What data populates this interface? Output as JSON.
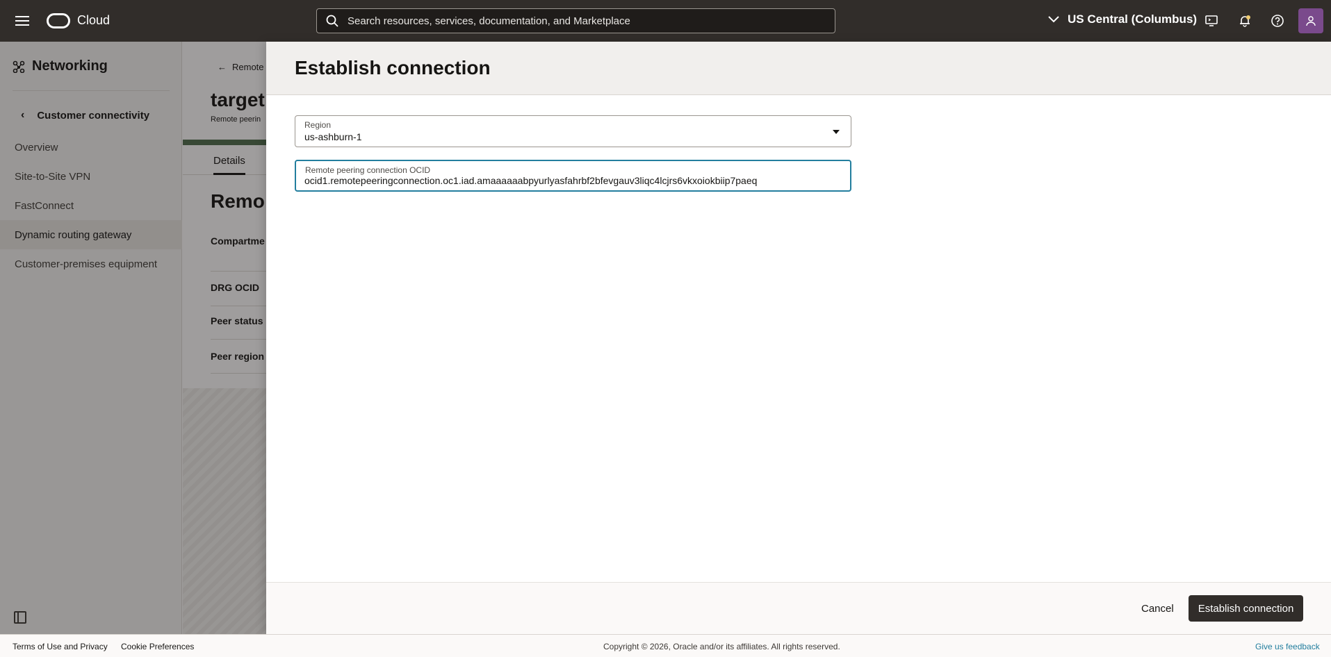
{
  "header": {
    "brand": "Cloud",
    "search_placeholder": "Search resources, services, documentation, and Marketplace",
    "region": "US Central (Columbus)",
    "icons": [
      "menu-icon",
      "oracle-logo",
      "search-icon",
      "chevron-down-icon",
      "cloud-shell-icon",
      "bell-icon",
      "help-icon",
      "user-icon"
    ]
  },
  "sidebar": {
    "title": "Networking",
    "back_label": "Customer connectivity",
    "items": [
      {
        "label": "Overview",
        "active": false
      },
      {
        "label": "Site-to-Site VPN",
        "active": false
      },
      {
        "label": "FastConnect",
        "active": false
      },
      {
        "label": "Dynamic routing gateway",
        "active": true
      },
      {
        "label": "Customer-premises equipment",
        "active": false
      }
    ]
  },
  "page": {
    "back_label": "Remote",
    "title": "target",
    "subtitle": "Remote peerin",
    "tab": "Details",
    "section_title": "Remo",
    "labels": [
      "Compartme",
      "DRG OCID",
      "Peer status",
      "Peer region"
    ]
  },
  "drawer": {
    "title": "Establish connection",
    "region_field": {
      "label": "Region",
      "value": "us-ashburn-1"
    },
    "ocid_field": {
      "label": "Remote peering connection OCID",
      "value": "ocid1.remotepeeringconnection.oc1.iad.amaaaaaabpyurlyasfahrbf2bfevgauv3liqc4lcjrs6vkxoiokbiip7paeq"
    },
    "cancel_label": "Cancel",
    "submit_label": "Establish connection"
  },
  "footer": {
    "terms": "Terms of Use and Privacy",
    "cookies": "Cookie Preferences",
    "copyright": "Copyright © 2026, Oracle and/or its affiliates. All rights reserved.",
    "feedback": "Give us feedback"
  },
  "colors": {
    "header_bg": "#312d2a",
    "primary_button": "#312d2a",
    "focus_border": "#227e9e",
    "link": "#227e9e"
  }
}
